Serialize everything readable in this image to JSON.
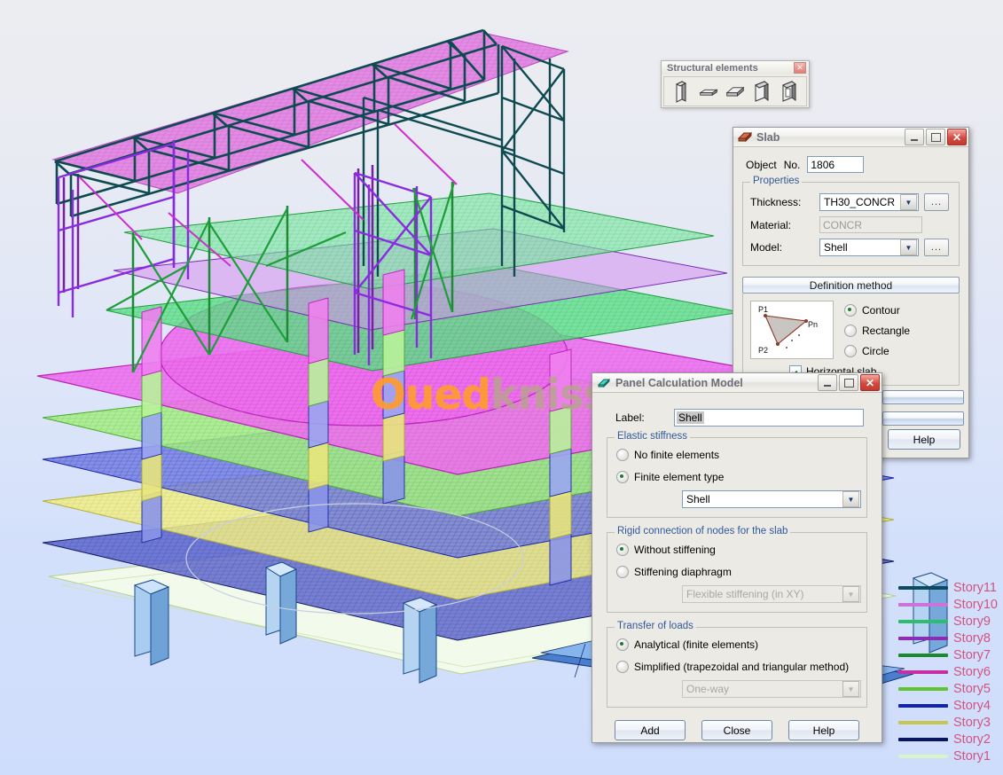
{
  "viewport": {
    "watermark_main": "Oued",
    "watermark_tail": "kniss.com"
  },
  "palette": {
    "title": "Structural elements",
    "close_icon": "close-icon",
    "tools": [
      {
        "name": "column-tool",
        "icon": "column-icon"
      },
      {
        "name": "beam-tool",
        "icon": "beam-icon"
      },
      {
        "name": "slab-tool",
        "icon": "slab-icon"
      },
      {
        "name": "wall-tool",
        "icon": "wall-icon"
      },
      {
        "name": "wall-opening-tool",
        "icon": "wall-opening-icon"
      }
    ]
  },
  "slab_dialog": {
    "title": "Slab",
    "icon": "slab-icon",
    "minimize": "minimize-icon",
    "maximize": "maximize-icon",
    "close": "close-icon",
    "object_label": "Object",
    "no_label": "No.",
    "object_no": "1806",
    "properties": {
      "group_label": "Properties",
      "thickness_label": "Thickness:",
      "thickness_value": "TH30_CONCR",
      "material_label": "Material:",
      "material_value": "CONCR",
      "model_label": "Model:",
      "model_value": "Shell",
      "browse_label": "..."
    },
    "definition": {
      "section_label": "Definition method",
      "diagram": {
        "p1": "P1",
        "p2": "P2",
        "pn": "Pn"
      },
      "options": [
        {
          "label": "Contour",
          "selected": true
        },
        {
          "label": "Rectangle",
          "selected": false
        },
        {
          "label": "Circle",
          "selected": false
        }
      ],
      "horizontal_slab_label": "Horizontal slab",
      "horizontal_slab_checked": true
    },
    "footer": {
      "help_label": "Help"
    }
  },
  "panel_dialog": {
    "title": "Panel Calculation Model",
    "icon": "panel-icon",
    "minimize": "minimize-icon",
    "maximize": "maximize-icon",
    "close": "close-icon",
    "label_caption": "Label:",
    "label_value": "Shell",
    "elastic_stiffness": {
      "group_label": "Elastic stiffness",
      "options": [
        {
          "label": "No finite elements",
          "selected": false
        },
        {
          "label": "Finite element type",
          "selected": true
        }
      ],
      "element_type_value": "Shell"
    },
    "rigid_connection": {
      "group_label": "Rigid connection of nodes for the slab",
      "options": [
        {
          "label": "Without stiffening",
          "selected": true
        },
        {
          "label": "Stiffening diaphragm",
          "selected": false
        }
      ],
      "stiffening_value": "Flexible stiffening (in XY)",
      "stiffening_disabled": true
    },
    "transfer_loads": {
      "group_label": "Transfer of loads",
      "options": [
        {
          "label": "Analytical (finite elements)",
          "selected": true
        },
        {
          "label": "Simplified (trapezoidal and triangular method)",
          "selected": false
        }
      ],
      "direction_value": "One-way",
      "direction_disabled": true
    },
    "buttons": {
      "add": "Add",
      "close": "Close",
      "help": "Help"
    }
  },
  "legend": {
    "title": "story-legend",
    "items": [
      {
        "label": "Story11",
        "color": "#0d4a5c"
      },
      {
        "label": "Story10",
        "color": "#cc72d8"
      },
      {
        "label": "Story9",
        "color": "#2dbd6e"
      },
      {
        "label": "Story8",
        "color": "#8a2fb5"
      },
      {
        "label": "Story7",
        "color": "#1c8a2c"
      },
      {
        "label": "Story6",
        "color": "#c92fa5"
      },
      {
        "label": "Story5",
        "color": "#5fc42e"
      },
      {
        "label": "Story4",
        "color": "#1424a8"
      },
      {
        "label": "Story3",
        "color": "#c8c552"
      },
      {
        "label": "Story2",
        "color": "#0a1560"
      },
      {
        "label": "Story1",
        "color": "#d8f5c8"
      }
    ]
  }
}
